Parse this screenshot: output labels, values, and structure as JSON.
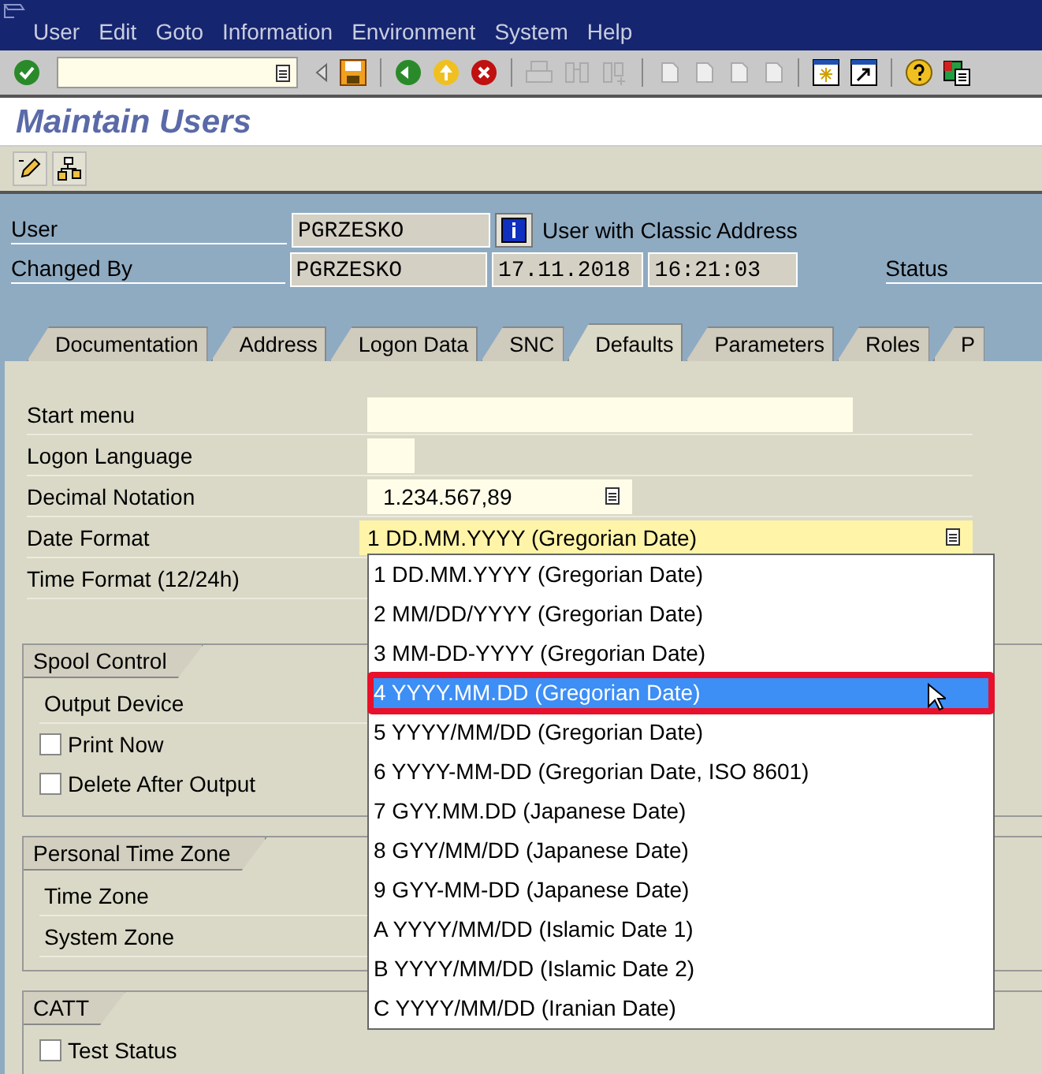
{
  "menu": [
    "User",
    "Edit",
    "Goto",
    "Information",
    "Environment",
    "System",
    "Help"
  ],
  "title": "Maintain Users",
  "header": {
    "user_label": "User",
    "user": "PGRZESKO",
    "user_note": "User with Classic Address",
    "changed_label": "Changed By",
    "changed_by": "PGRZESKO",
    "date": "17.11.2018",
    "time": "16:21:03",
    "status_label": "Status"
  },
  "tabs": [
    {
      "label": "Documentation",
      "selected": false
    },
    {
      "label": "Address",
      "selected": false
    },
    {
      "label": "Logon Data",
      "selected": false
    },
    {
      "label": "SNC",
      "selected": false
    },
    {
      "label": "Defaults",
      "selected": true
    },
    {
      "label": "Parameters",
      "selected": false
    },
    {
      "label": "Roles",
      "selected": false
    },
    {
      "label": "P",
      "selected": false
    }
  ],
  "fields": [
    {
      "label": "Start menu",
      "kind": "wide"
    },
    {
      "label": "Logon Language",
      "kind": "short"
    },
    {
      "label": "Decimal Notation",
      "kind": "list",
      "value": "1.234.567,89"
    },
    {
      "label": "Date Format",
      "kind": "focus",
      "value": "1 DD.MM.YYYY (Gregorian Date)"
    },
    {
      "label": "Time Format (12/24h)",
      "kind": "hidden"
    }
  ],
  "groups": [
    {
      "title": "Spool Control",
      "rows": [
        {
          "kind": "label",
          "label": "Output Device"
        },
        {
          "kind": "checkbox",
          "label": "Print Now",
          "checked": false
        },
        {
          "kind": "checkbox",
          "label": "Delete After Output",
          "checked": false
        }
      ]
    },
    {
      "title": "Personal Time Zone",
      "rows": [
        {
          "kind": "label",
          "label": "Time Zone"
        },
        {
          "kind": "label",
          "label": "System Zone"
        }
      ]
    },
    {
      "title": "CATT",
      "rows": [
        {
          "kind": "checkbox",
          "label": "Test Status",
          "checked": false
        }
      ]
    }
  ],
  "dropdown": [
    {
      "label": "1 DD.MM.YYYY (Gregorian Date)",
      "selected": false
    },
    {
      "label": "2 MM/DD/YYYY (Gregorian Date)",
      "selected": false
    },
    {
      "label": "3 MM-DD-YYYY (Gregorian Date)",
      "selected": false
    },
    {
      "label": "4 YYYY.MM.DD (Gregorian Date)",
      "selected": true
    },
    {
      "label": "5 YYYY/MM/DD (Gregorian Date)",
      "selected": false
    },
    {
      "label": "6 YYYY-MM-DD (Gregorian Date, ISO 8601)",
      "selected": false
    },
    {
      "label": "7 GYY.MM.DD (Japanese Date)",
      "selected": false
    },
    {
      "label": "8 GYY/MM/DD (Japanese Date)",
      "selected": false
    },
    {
      "label": "9 GYY-MM-DD (Japanese Date)",
      "selected": false
    },
    {
      "label": "A YYYY/MM/DD (Islamic Date 1)",
      "selected": false
    },
    {
      "label": "B YYYY/MM/DD (Islamic Date 2)",
      "selected": false
    },
    {
      "label": "C YYYY/MM/DD (Iranian Date)",
      "selected": false
    }
  ]
}
